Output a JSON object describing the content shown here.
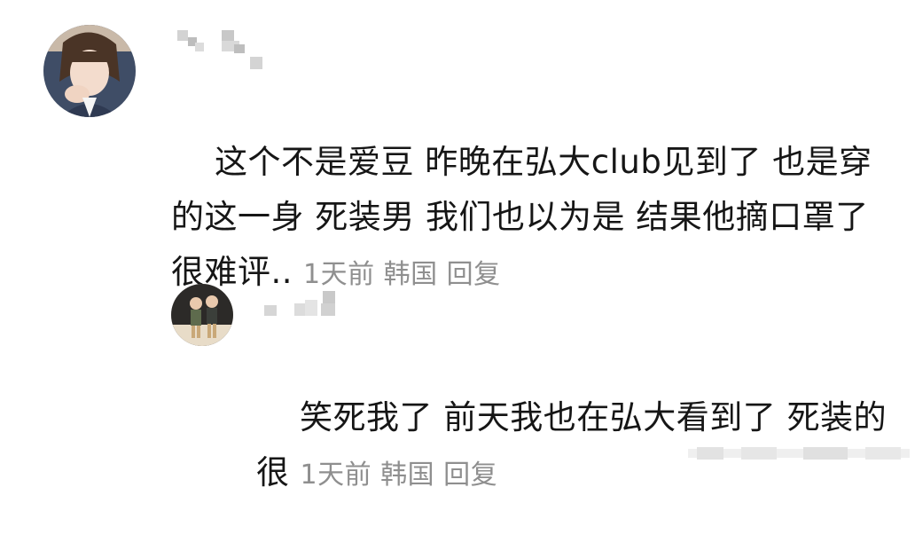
{
  "comments": [
    {
      "avatar_icon": "user-avatar-icon",
      "text": "这个不是爱豆 昨晚在弘大club见到了 也是穿的这一身 死装男 我们也以为是 结果他摘口罩了 很难评..",
      "time": "1天前",
      "location": "韩国",
      "reply_label": "回复"
    },
    {
      "avatar_icon": "user-avatar-icon",
      "text": "笑死我了 前天我也在弘大看到了 死装的很",
      "time": "1天前",
      "location": "韩国",
      "reply_label": "回复"
    }
  ],
  "colors": {
    "text": "#161616",
    "meta": "#8f8f8f",
    "mosaic": "#cfcfcf"
  }
}
